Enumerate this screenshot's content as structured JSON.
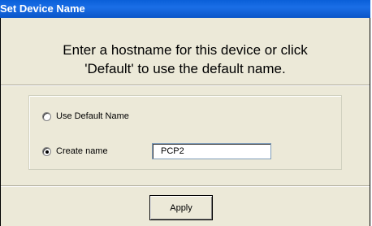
{
  "window": {
    "title": "Set Device Name"
  },
  "prompt": {
    "line1": "Enter a hostname for this device or click",
    "line2": "'Default' to use the default name."
  },
  "options": {
    "default": {
      "label": "Use Default Name",
      "checked": false
    },
    "create": {
      "label": "Create name",
      "checked": true
    }
  },
  "hostname": {
    "value": "PCP2"
  },
  "buttons": {
    "apply": "Apply"
  }
}
